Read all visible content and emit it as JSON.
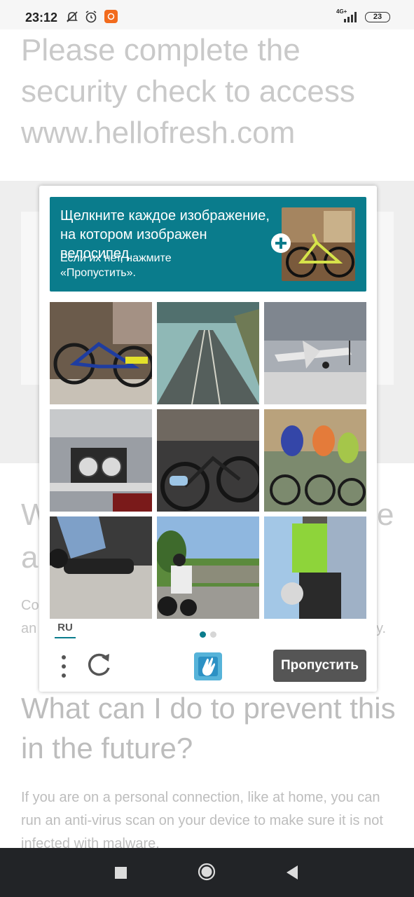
{
  "status_bar": {
    "time": "23:12",
    "icons": [
      "mute-icon",
      "alarm-icon",
      "app-notification-icon"
    ],
    "network": "4G+",
    "battery": "23"
  },
  "page": {
    "title": "Please complete the security check to access www.hellofresh.com",
    "heading2_left_line1": "W",
    "heading2_left_line2": "a",
    "heading2_right_line1": "e",
    "body2_left_line1": "Co",
    "body2_left_line2": "an",
    "body2_right_line2": "y.",
    "section_heading": "What can I do to prevent this in the future?",
    "section_body": "If you are on a personal connection, like at home, you can run an anti-virus scan on your device to make sure it is not infected with malware."
  },
  "captcha": {
    "prompt_title": "Щелкните каждое изображение, на котором изображен велосипед",
    "prompt_subtitle": "Если их нет, нажмите «Пропустить».",
    "example_image": "bicycle-example-image",
    "tiles": [
      {
        "name": "tile-1",
        "subject": "bicycle"
      },
      {
        "name": "tile-2",
        "subject": "railway-tracks"
      },
      {
        "name": "tile-3",
        "subject": "airplane"
      },
      {
        "name": "tile-4",
        "subject": "motorcycle-dashboard"
      },
      {
        "name": "tile-5",
        "subject": "bicycle"
      },
      {
        "name": "tile-6",
        "subject": "cyclists"
      },
      {
        "name": "tile-7",
        "subject": "motorcycle"
      },
      {
        "name": "tile-8",
        "subject": "motorcycle-rider"
      },
      {
        "name": "tile-9",
        "subject": "motorcycle"
      }
    ],
    "language": "RU",
    "page_indicator": {
      "current": 1,
      "total": 2
    },
    "skip_label": "Пропустить",
    "accent_color": "#0a7c8c"
  },
  "nav_bar": {
    "buttons": [
      "recents-button",
      "home-button",
      "back-button"
    ]
  }
}
